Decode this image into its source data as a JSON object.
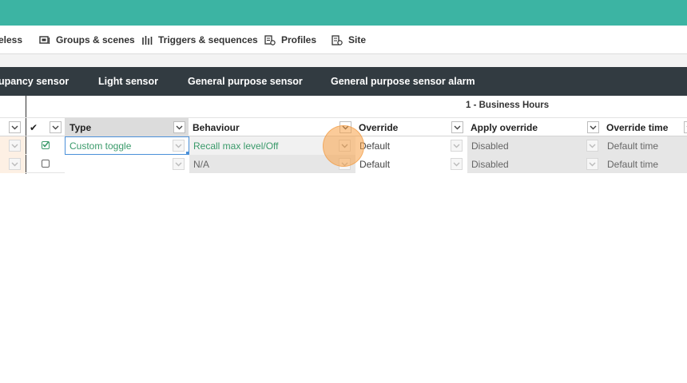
{
  "nav": {
    "items": [
      {
        "label": "eless",
        "icon": "wireless-icon"
      },
      {
        "label": "Groups & scenes",
        "icon": "groups-icon"
      },
      {
        "label": "Triggers & sequences",
        "icon": "triggers-icon"
      },
      {
        "label": "Profiles",
        "icon": "profiles-icon"
      },
      {
        "label": "Site",
        "icon": "site-icon"
      }
    ]
  },
  "tabs": [
    "upancy sensor",
    "Light sensor",
    "General purpose sensor",
    "General purpose sensor alarm"
  ],
  "table": {
    "group_title": "1 - Business Hours",
    "select_all_icon": "✔",
    "headers": {
      "type": "Type",
      "behaviour": "Behaviour",
      "override": "Override",
      "apply_override": "Apply override",
      "override_time": "Override time"
    },
    "rows": [
      {
        "checked": true,
        "type": "Custom toggle",
        "behaviour": "Recall max level/Off",
        "override": "Default",
        "apply_override": "Disabled",
        "override_time": "Default time"
      },
      {
        "checked": false,
        "type": "",
        "behaviour": "N/A",
        "override": "Default",
        "apply_override": "Disabled",
        "override_time": "Default time"
      }
    ]
  },
  "colors": {
    "topbar": "#3cb4a3",
    "tabbar": "#323b41",
    "selected_row": "#fdf0e4",
    "accent_text": "#3a9a6a",
    "cursor_ripple": "#f7a046"
  }
}
